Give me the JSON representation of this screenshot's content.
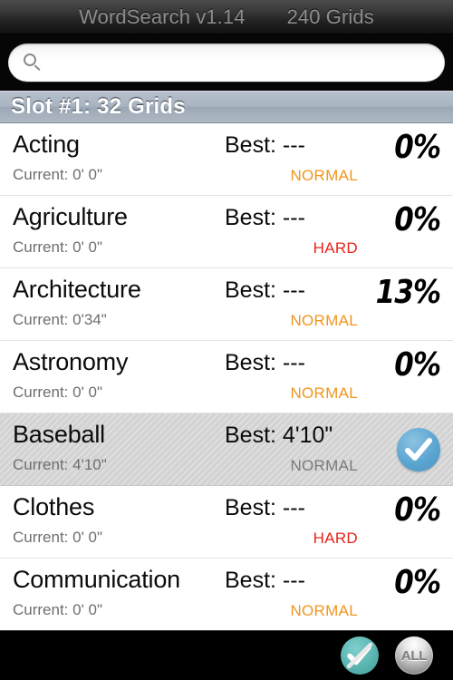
{
  "titlebar": {
    "app_title": "WordSearch v1.14",
    "grid_count": "240 Grids"
  },
  "search": {
    "value": "",
    "placeholder": "",
    "icon": "search-icon"
  },
  "section": {
    "header": "Slot #1: 32 Grids"
  },
  "colors": {
    "normal": "#F0951E",
    "hard": "#E8231A",
    "normal_selected": "#7a7a7a",
    "check_badge": "#5ba5d2",
    "toolbar_check": "#56b2ad"
  },
  "labels": {
    "best_prefix": "Best:",
    "current_prefix": "Current:"
  },
  "rows": [
    {
      "name": "Acting",
      "current": "Current: 0' 0\"",
      "best": "Best: ---",
      "difficulty": "NORMAL",
      "difficulty_kind": "normal",
      "percent": "0%",
      "completed": false
    },
    {
      "name": "Agriculture",
      "current": "Current: 0' 0\"",
      "best": "Best: ---",
      "difficulty": "HARD",
      "difficulty_kind": "hard",
      "percent": "0%",
      "completed": false
    },
    {
      "name": "Architecture",
      "current": "Current: 0'34\"",
      "best": "Best: ---",
      "difficulty": "NORMAL",
      "difficulty_kind": "normal",
      "percent": "13%",
      "completed": false
    },
    {
      "name": "Astronomy",
      "current": "Current: 0' 0\"",
      "best": "Best: ---",
      "difficulty": "NORMAL",
      "difficulty_kind": "normal",
      "percent": "0%",
      "completed": false
    },
    {
      "name": "Baseball",
      "current": "Current: 4'10\"",
      "best": "Best: 4'10\"",
      "difficulty": "NORMAL",
      "difficulty_kind": "normal_selected",
      "percent": "",
      "completed": true
    },
    {
      "name": "Clothes",
      "current": "Current: 0' 0\"",
      "best": "Best: ---",
      "difficulty": "HARD",
      "difficulty_kind": "hard",
      "percent": "0%",
      "completed": false
    },
    {
      "name": "Communication",
      "current": "Current: 0' 0\"",
      "best": "Best: ---",
      "difficulty": "NORMAL",
      "difficulty_kind": "normal",
      "percent": "0%",
      "completed": false
    }
  ],
  "toolbar": {
    "filter_completed_label": "",
    "show_all_label": "ALL"
  }
}
